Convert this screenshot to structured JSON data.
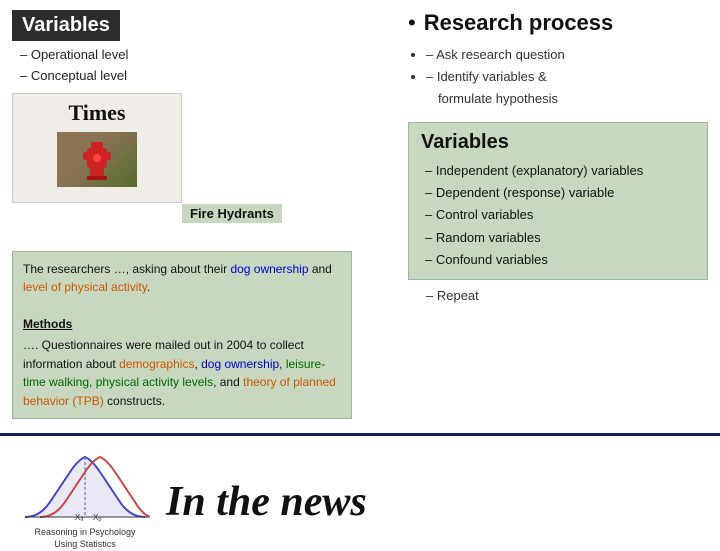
{
  "left": {
    "title": "Variables",
    "subtitle_items": [
      "– Operational level",
      "– Conceptual level"
    ]
  },
  "newspaper": {
    "title": "Times",
    "fire_hydrant_label": "Fire Hydrants"
  },
  "green_box": {
    "intro": "The researchers …, asking about their dog ownership and level of physical activity.",
    "intro_plain1": "The researchers …, asking about their ",
    "intro_highlight1": "dog ownership",
    "intro_mid": " and ",
    "intro_highlight2": "level of physical activity",
    "intro_end": ".",
    "methods_title": "Methods",
    "methods_text": "…. Questionnaires were mailed out in 2004 to collect information about ",
    "highlight_demographics": "demographics",
    "methods_mid1": ", ",
    "highlight_dog": "dog ownership",
    "methods_mid2": ", ",
    "highlight_walking": "leisure-time walking, physical activity levels",
    "methods_mid3": ", and ",
    "highlight_tpb": "theory of planned behavior (TPB)",
    "methods_end": " constructs."
  },
  "research": {
    "bullet": "•",
    "title": "Research process",
    "items": [
      "– Ask research question",
      "– Identify variables & formulate hypothesis"
    ],
    "item1": "– Ask research question",
    "item2_1": "– Identify variables &",
    "item2_2": "formulate hypothesis"
  },
  "variables_right": {
    "title": "Variables",
    "items": [
      "– Independent (explanatory) variables",
      "– Dependent (response) variable",
      "– Control variables",
      "– Random variables",
      "– Confound variables"
    ]
  },
  "repeat": {
    "label": "– Repeat"
  },
  "bottom": {
    "curve_label": "Reasoning in Psychology\nUsing Statistics",
    "news_title": "In the news"
  }
}
